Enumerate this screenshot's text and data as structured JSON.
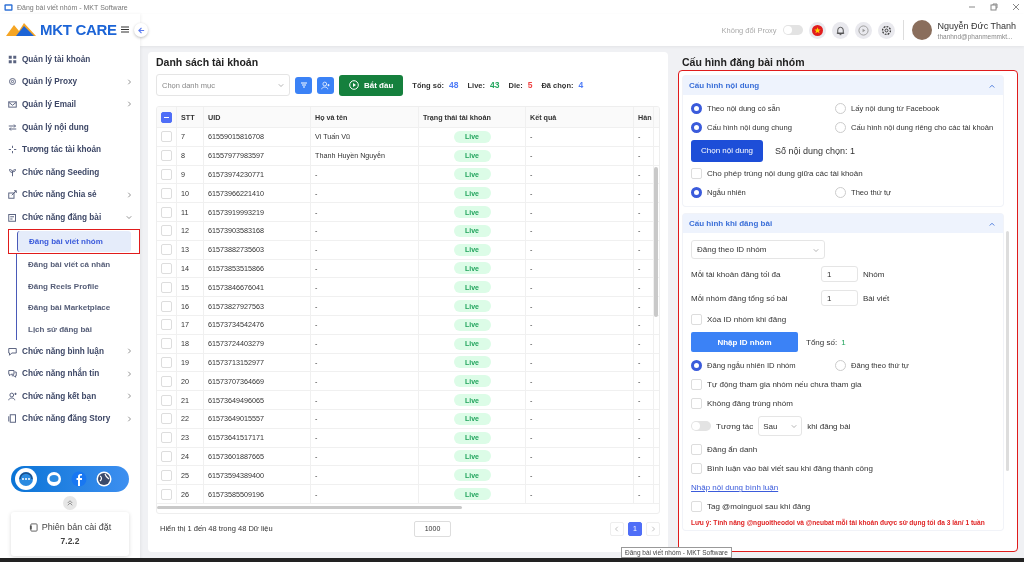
{
  "window": {
    "title": "Đăng bài viết nhóm - MKT Software"
  },
  "header": {
    "logo": "MKT CARE",
    "proxy_label": "Không đổi Proxy",
    "proxy_on": false,
    "user_name": "Nguyễn Đức Thanh",
    "user_email": "thanhnd@phanmemmkt..."
  },
  "sidebar": {
    "items": [
      {
        "label": "Quản lý tài khoản",
        "has_submenu": false
      },
      {
        "label": "Quản lý Proxy",
        "has_submenu": true,
        "expanded": false
      },
      {
        "label": "Quản lý Email",
        "has_submenu": true,
        "expanded": false
      },
      {
        "label": "Quản lý nội dung",
        "has_submenu": false
      },
      {
        "label": "Tương tác tài khoản",
        "has_submenu": false
      },
      {
        "label": "Chức năng Seeding",
        "has_submenu": false
      },
      {
        "label": "Chức năng Chia sẻ",
        "has_submenu": true,
        "expanded": false
      },
      {
        "label": "Chức năng đăng bài",
        "has_submenu": true,
        "expanded": true,
        "children": [
          {
            "label": "Đăng bài viết nhóm",
            "selected": true
          },
          {
            "label": "Đăng bài viết cá nhân",
            "selected": false
          },
          {
            "label": "Đăng Reels Profile",
            "selected": false
          },
          {
            "label": "Đăng bài Marketplace",
            "selected": false
          },
          {
            "label": "Lịch sử đăng bài",
            "selected": false
          }
        ]
      },
      {
        "label": "Chức năng bình luận",
        "has_submenu": true,
        "expanded": false
      },
      {
        "label": "Chức năng nhắn tin",
        "has_submenu": true,
        "expanded": false
      },
      {
        "label": "Chức năng kết bạn",
        "has_submenu": true,
        "expanded": false
      },
      {
        "label": "Chức năng đăng Story",
        "has_submenu": true,
        "expanded": false
      }
    ],
    "version_label": "Phiên bản cài đặt",
    "version": "7.2.2"
  },
  "accounts": {
    "title": "Danh sách tài khoản",
    "category_placeholder": "Chọn danh mục",
    "start_button": "Bắt đầu",
    "stats": [
      {
        "label": "Tổng số:",
        "value": "48",
        "color": "#4f7cf7"
      },
      {
        "label": "Live:",
        "value": "43",
        "color": "#22a45d"
      },
      {
        "label": "Die:",
        "value": "5",
        "color": "#ef4444"
      },
      {
        "label": "Đã chọn:",
        "value": "4",
        "color": "#4f7cf7"
      }
    ],
    "select_all_indeterminate": true,
    "columns": [
      "STT",
      "UID",
      "Họ và tên",
      "Trạng thái tài khoản",
      "Kết quả",
      "Hàn"
    ],
    "rows": [
      {
        "stt": "7",
        "uid": "61559015816708",
        "name": "Vi Tuấn Vũ",
        "status": "Live",
        "result": "-",
        "action": "-",
        "checked": false
      },
      {
        "stt": "8",
        "uid": "61557977983597",
        "name": "Thanh Huyền Nguyễn",
        "status": "Live",
        "result": "-",
        "action": "-",
        "checked": false
      },
      {
        "stt": "9",
        "uid": "61573974230771",
        "name": "-",
        "status": "Live",
        "result": "-",
        "action": "-",
        "checked": false
      },
      {
        "stt": "10",
        "uid": "61573966221410",
        "name": "-",
        "status": "Live",
        "result": "-",
        "action": "-",
        "checked": false
      },
      {
        "stt": "11",
        "uid": "61573919993219",
        "name": "-",
        "status": "Live",
        "result": "-",
        "action": "-",
        "checked": false
      },
      {
        "stt": "12",
        "uid": "61573903583168",
        "name": "-",
        "status": "Live",
        "result": "-",
        "action": "-",
        "checked": false
      },
      {
        "stt": "13",
        "uid": "61573882735603",
        "name": "-",
        "status": "Live",
        "result": "-",
        "action": "-",
        "checked": false
      },
      {
        "stt": "14",
        "uid": "61573853515866",
        "name": "-",
        "status": "Live",
        "result": "-",
        "action": "-",
        "checked": false
      },
      {
        "stt": "15",
        "uid": "61573846676041",
        "name": "-",
        "status": "Live",
        "result": "-",
        "action": "-",
        "checked": false
      },
      {
        "stt": "16",
        "uid": "61573827927563",
        "name": "-",
        "status": "Live",
        "result": "-",
        "action": "-",
        "checked": false
      },
      {
        "stt": "17",
        "uid": "61573734542476",
        "name": "-",
        "status": "Live",
        "result": "-",
        "action": "-",
        "checked": false
      },
      {
        "stt": "18",
        "uid": "61573724403279",
        "name": "-",
        "status": "Live",
        "result": "-",
        "action": "-",
        "checked": false
      },
      {
        "stt": "19",
        "uid": "61573713152977",
        "name": "-",
        "status": "Live",
        "result": "-",
        "action": "-",
        "checked": false
      },
      {
        "stt": "20",
        "uid": "61573707364669",
        "name": "-",
        "status": "Live",
        "result": "-",
        "action": "-",
        "checked": false
      },
      {
        "stt": "21",
        "uid": "61573649496065",
        "name": "-",
        "status": "Live",
        "result": "-",
        "action": "-",
        "checked": false
      },
      {
        "stt": "22",
        "uid": "61573649015557",
        "name": "-",
        "status": "Live",
        "result": "-",
        "action": "-",
        "checked": false
      },
      {
        "stt": "23",
        "uid": "61573641517171",
        "name": "-",
        "status": "Live",
        "result": "-",
        "action": "-",
        "checked": false
      },
      {
        "stt": "24",
        "uid": "61573601887665",
        "name": "-",
        "status": "Live",
        "result": "-",
        "action": "-",
        "checked": false
      },
      {
        "stt": "25",
        "uid": "61573594389400",
        "name": "-",
        "status": "Live",
        "result": "-",
        "action": "-",
        "checked": false
      },
      {
        "stt": "26",
        "uid": "61573585509196",
        "name": "-",
        "status": "Live",
        "result": "-",
        "action": "-",
        "checked": false
      }
    ],
    "footer": "Hiển thị 1 đến 48 trong 48 Dữ liệu",
    "page_size": "1000",
    "pages": [
      {
        "label": "1",
        "selected": true
      }
    ]
  },
  "config": {
    "title": "Cấu hình đăng bài nhóm",
    "sections": [
      {
        "title": "Cấu hình nội dung",
        "expanded": true,
        "items": [
          {
            "kind": "radio",
            "options": [
              {
                "label": "Theo nội dung có sẵn",
                "selected": true
              },
              {
                "label": "Lấy nội dung từ Facebook",
                "selected": false
              }
            ]
          },
          {
            "kind": "radio",
            "options": [
              {
                "label": "Cấu hình nội dung chung",
                "selected": true
              },
              {
                "label": "Cấu hình nội dung riêng cho các tài khoản",
                "selected": false
              }
            ]
          },
          {
            "kind": "button_count",
            "button": "Chọn nội dung",
            "text": "Số nội dung chọn: 1"
          },
          {
            "kind": "checkbox",
            "label": "Cho phép trùng nội dung giữa các tài khoản",
            "checked": false
          },
          {
            "kind": "radio",
            "options": [
              {
                "label": "Ngẫu nhiên",
                "selected": true
              },
              {
                "label": "Theo thứ tự",
                "selected": false
              }
            ]
          }
        ]
      },
      {
        "title": "Cấu hình khi đăng bài",
        "expanded": true,
        "items": [
          {
            "kind": "select",
            "value": "Đăng theo ID nhóm"
          },
          {
            "kind": "number",
            "label": "Mỗi tài khoản đăng tối đa",
            "value": "1",
            "unit": "Nhóm"
          },
          {
            "kind": "number",
            "label": "Mỗi nhóm đăng tổng số bài",
            "value": "1",
            "unit": "Bài viết"
          },
          {
            "kind": "checkbox",
            "label": "Xóa ID nhóm khi đăng",
            "checked": false
          },
          {
            "kind": "button_total",
            "button": "Nhập ID nhóm",
            "text": "Tổng số:",
            "count": "1"
          },
          {
            "kind": "radio",
            "options": [
              {
                "label": "Đăng ngẫu nhiên ID nhóm",
                "selected": true
              },
              {
                "label": "Đăng theo thứ tự",
                "selected": false
              }
            ]
          },
          {
            "kind": "checkbox",
            "label": "Tự động tham gia nhóm nếu chưa tham gia",
            "checked": false
          },
          {
            "kind": "checkbox",
            "label": "Không đăng trùng nhóm",
            "checked": false
          },
          {
            "kind": "toggle",
            "on": false,
            "label": "Tương tác",
            "select": "Sau",
            "suffix": "khi đăng bài"
          },
          {
            "kind": "checkbox",
            "label": "Đăng ẩn danh",
            "checked": false
          },
          {
            "kind": "checkbox",
            "label": "Bình luận vào bài viết sau khi đăng thành công",
            "checked": false
          },
          {
            "kind": "link",
            "label": "Nhập nội dung bình luận"
          },
          {
            "kind": "checkbox",
            "label": "Tag @moinguoi sau khi đăng",
            "checked": false
          },
          {
            "kind": "note",
            "text": "Lưu ý: Tính năng @nguoitheodoi và @neubat mỗi tài khoản được sử dụng tối đa 3 lần/ 1 tuần"
          }
        ]
      }
    ]
  },
  "tooltip": "Đăng bài viết nhóm - MKT Software"
}
